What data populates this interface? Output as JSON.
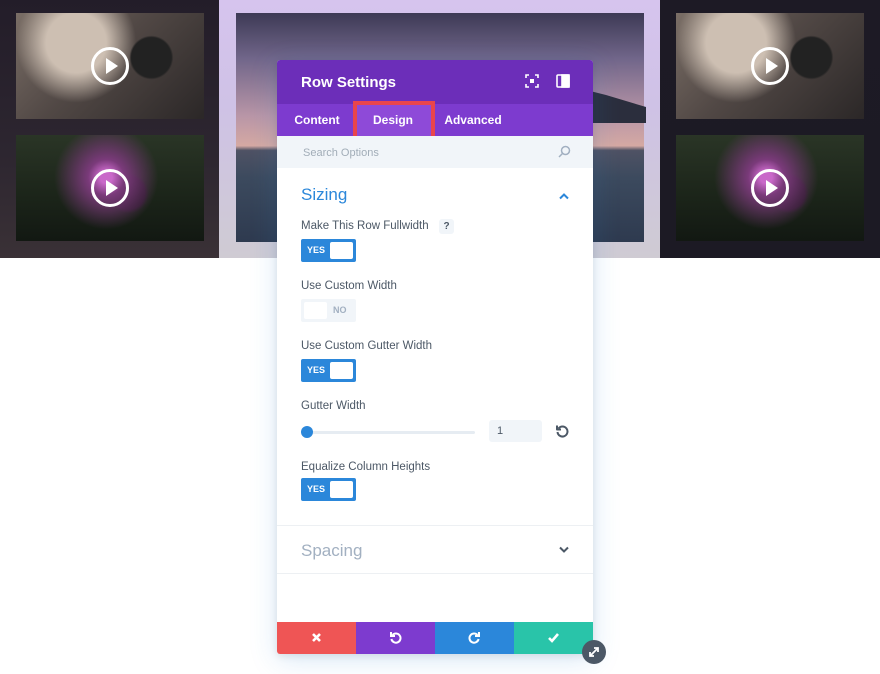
{
  "colors": {
    "header": "#6c2eb9",
    "tabs": "#7d3bcf",
    "accent": "#2b87da",
    "highlight": "#e9454c",
    "discard": "#ef5555",
    "undo": "#7d3bcf",
    "redo": "#2b87da",
    "save": "#29c4a9"
  },
  "modal": {
    "title": "Row Settings",
    "header_icons": [
      "focus-icon",
      "split-view-icon"
    ],
    "tabs": [
      {
        "label": "Content",
        "active": false
      },
      {
        "label": "Design",
        "active": true
      },
      {
        "label": "Advanced",
        "active": false
      }
    ],
    "search": {
      "placeholder": "Search Options",
      "value": ""
    },
    "sections": {
      "sizing": {
        "title": "Sizing",
        "expanded": true,
        "fields": {
          "fullwidth": {
            "label": "Make This Row Fullwidth",
            "help": "?",
            "value": "YES"
          },
          "custom_width": {
            "label": "Use Custom Width",
            "value": "NO"
          },
          "custom_gutter": {
            "label": "Use Custom Gutter Width",
            "value": "YES"
          },
          "gutter_width": {
            "label": "Gutter Width",
            "value": "1"
          },
          "equalize": {
            "label": "Equalize Column Heights",
            "value": "YES"
          }
        }
      },
      "spacing": {
        "title": "Spacing",
        "expanded": false
      }
    },
    "footer": {
      "buttons": [
        "discard-icon",
        "undo-icon",
        "redo-icon",
        "save-icon"
      ]
    }
  },
  "background": {
    "video_thumbnails": [
      "camera",
      "concert",
      "camera",
      "concert"
    ]
  }
}
